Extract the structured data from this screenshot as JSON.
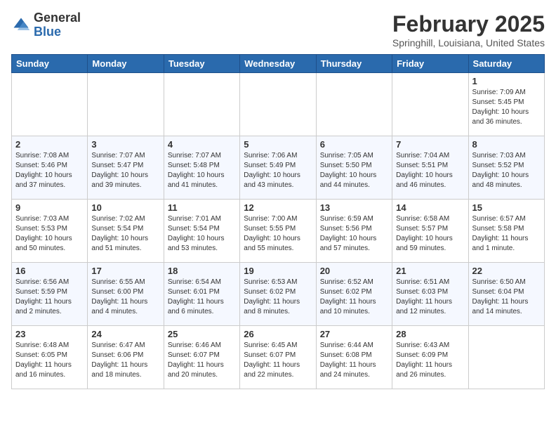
{
  "header": {
    "logo_general": "General",
    "logo_blue": "Blue",
    "month": "February 2025",
    "location": "Springhill, Louisiana, United States"
  },
  "weekdays": [
    "Sunday",
    "Monday",
    "Tuesday",
    "Wednesday",
    "Thursday",
    "Friday",
    "Saturday"
  ],
  "weeks": [
    [
      {
        "day": "",
        "info": ""
      },
      {
        "day": "",
        "info": ""
      },
      {
        "day": "",
        "info": ""
      },
      {
        "day": "",
        "info": ""
      },
      {
        "day": "",
        "info": ""
      },
      {
        "day": "",
        "info": ""
      },
      {
        "day": "1",
        "info": "Sunrise: 7:09 AM\nSunset: 5:45 PM\nDaylight: 10 hours\nand 36 minutes."
      }
    ],
    [
      {
        "day": "2",
        "info": "Sunrise: 7:08 AM\nSunset: 5:46 PM\nDaylight: 10 hours\nand 37 minutes."
      },
      {
        "day": "3",
        "info": "Sunrise: 7:07 AM\nSunset: 5:47 PM\nDaylight: 10 hours\nand 39 minutes."
      },
      {
        "day": "4",
        "info": "Sunrise: 7:07 AM\nSunset: 5:48 PM\nDaylight: 10 hours\nand 41 minutes."
      },
      {
        "day": "5",
        "info": "Sunrise: 7:06 AM\nSunset: 5:49 PM\nDaylight: 10 hours\nand 43 minutes."
      },
      {
        "day": "6",
        "info": "Sunrise: 7:05 AM\nSunset: 5:50 PM\nDaylight: 10 hours\nand 44 minutes."
      },
      {
        "day": "7",
        "info": "Sunrise: 7:04 AM\nSunset: 5:51 PM\nDaylight: 10 hours\nand 46 minutes."
      },
      {
        "day": "8",
        "info": "Sunrise: 7:03 AM\nSunset: 5:52 PM\nDaylight: 10 hours\nand 48 minutes."
      }
    ],
    [
      {
        "day": "9",
        "info": "Sunrise: 7:03 AM\nSunset: 5:53 PM\nDaylight: 10 hours\nand 50 minutes."
      },
      {
        "day": "10",
        "info": "Sunrise: 7:02 AM\nSunset: 5:54 PM\nDaylight: 10 hours\nand 51 minutes."
      },
      {
        "day": "11",
        "info": "Sunrise: 7:01 AM\nSunset: 5:54 PM\nDaylight: 10 hours\nand 53 minutes."
      },
      {
        "day": "12",
        "info": "Sunrise: 7:00 AM\nSunset: 5:55 PM\nDaylight: 10 hours\nand 55 minutes."
      },
      {
        "day": "13",
        "info": "Sunrise: 6:59 AM\nSunset: 5:56 PM\nDaylight: 10 hours\nand 57 minutes."
      },
      {
        "day": "14",
        "info": "Sunrise: 6:58 AM\nSunset: 5:57 PM\nDaylight: 10 hours\nand 59 minutes."
      },
      {
        "day": "15",
        "info": "Sunrise: 6:57 AM\nSunset: 5:58 PM\nDaylight: 11 hours\nand 1 minute."
      }
    ],
    [
      {
        "day": "16",
        "info": "Sunrise: 6:56 AM\nSunset: 5:59 PM\nDaylight: 11 hours\nand 2 minutes."
      },
      {
        "day": "17",
        "info": "Sunrise: 6:55 AM\nSunset: 6:00 PM\nDaylight: 11 hours\nand 4 minutes."
      },
      {
        "day": "18",
        "info": "Sunrise: 6:54 AM\nSunset: 6:01 PM\nDaylight: 11 hours\nand 6 minutes."
      },
      {
        "day": "19",
        "info": "Sunrise: 6:53 AM\nSunset: 6:02 PM\nDaylight: 11 hours\nand 8 minutes."
      },
      {
        "day": "20",
        "info": "Sunrise: 6:52 AM\nSunset: 6:02 PM\nDaylight: 11 hours\nand 10 minutes."
      },
      {
        "day": "21",
        "info": "Sunrise: 6:51 AM\nSunset: 6:03 PM\nDaylight: 11 hours\nand 12 minutes."
      },
      {
        "day": "22",
        "info": "Sunrise: 6:50 AM\nSunset: 6:04 PM\nDaylight: 11 hours\nand 14 minutes."
      }
    ],
    [
      {
        "day": "23",
        "info": "Sunrise: 6:48 AM\nSunset: 6:05 PM\nDaylight: 11 hours\nand 16 minutes."
      },
      {
        "day": "24",
        "info": "Sunrise: 6:47 AM\nSunset: 6:06 PM\nDaylight: 11 hours\nand 18 minutes."
      },
      {
        "day": "25",
        "info": "Sunrise: 6:46 AM\nSunset: 6:07 PM\nDaylight: 11 hours\nand 20 minutes."
      },
      {
        "day": "26",
        "info": "Sunrise: 6:45 AM\nSunset: 6:07 PM\nDaylight: 11 hours\nand 22 minutes."
      },
      {
        "day": "27",
        "info": "Sunrise: 6:44 AM\nSunset: 6:08 PM\nDaylight: 11 hours\nand 24 minutes."
      },
      {
        "day": "28",
        "info": "Sunrise: 6:43 AM\nSunset: 6:09 PM\nDaylight: 11 hours\nand 26 minutes."
      },
      {
        "day": "",
        "info": ""
      }
    ]
  ]
}
